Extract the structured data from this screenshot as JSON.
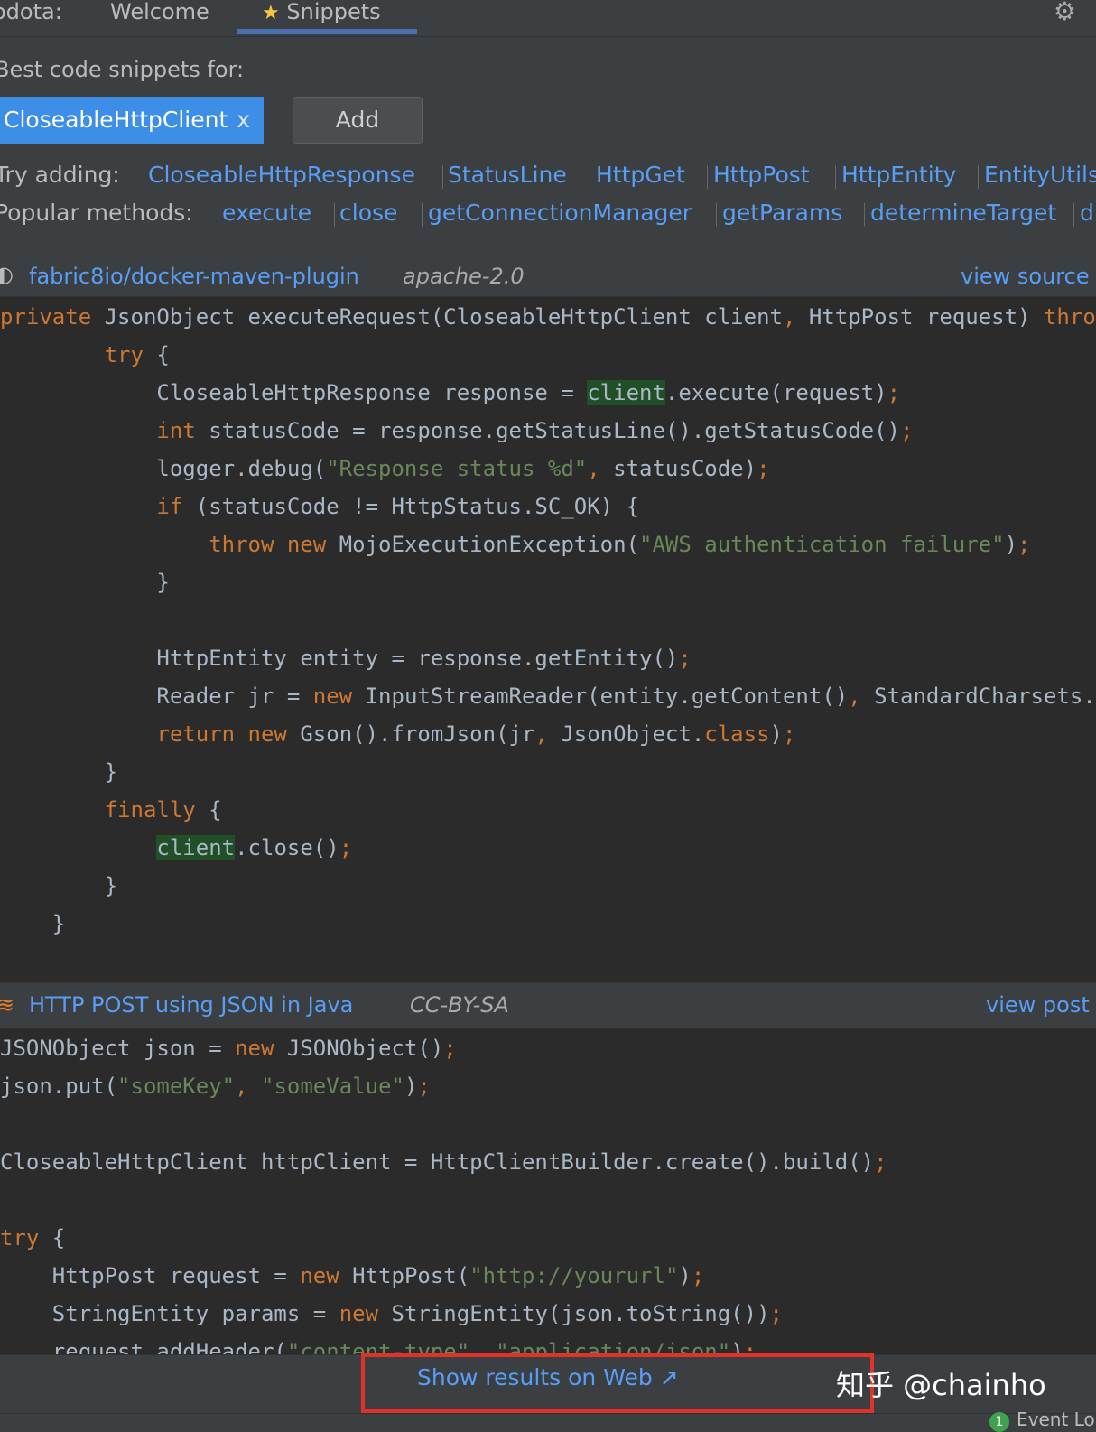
{
  "tabbar": {
    "prefix": "odota:",
    "welcome_label": "Welcome",
    "snippets_label": "Snippets",
    "active_underline_color": "#4b6eaf"
  },
  "header": {
    "best_for_label": "Best code snippets for:",
    "selected_class": "CloseableHttpClient",
    "remove_label": "x",
    "add_label": "Add",
    "try_adding_label": "Try adding:",
    "try_adding": [
      "CloseableHttpResponse",
      "StatusLine",
      "HttpGet",
      "HttpPost",
      "HttpEntity",
      "EntityUtils"
    ],
    "popular_methods_label": "Popular methods:",
    "popular_methods": [
      "execute",
      "close",
      "getConnectionManager",
      "getParams",
      "determineTarget",
      "d"
    ]
  },
  "snippet1": {
    "repo": "fabric8io/docker-maven-plugin",
    "license": "apache-2.0",
    "view_label": "view source"
  },
  "snippet2": {
    "title": "HTTP POST using JSON in Java",
    "license": "CC-BY-SA",
    "view_label": "view post"
  },
  "footer": {
    "show_web_label": "Show results on Web ↗",
    "watermark": "知乎 @chainho",
    "event_badge": "1",
    "event_log_label": "Event Lo"
  },
  "colors": {
    "accent": "#3d8ee6",
    "link": "#589df6",
    "keyword": "#cc7832",
    "string": "#6a8759",
    "highlight": "#214f27",
    "red_box": "#e0322a"
  }
}
